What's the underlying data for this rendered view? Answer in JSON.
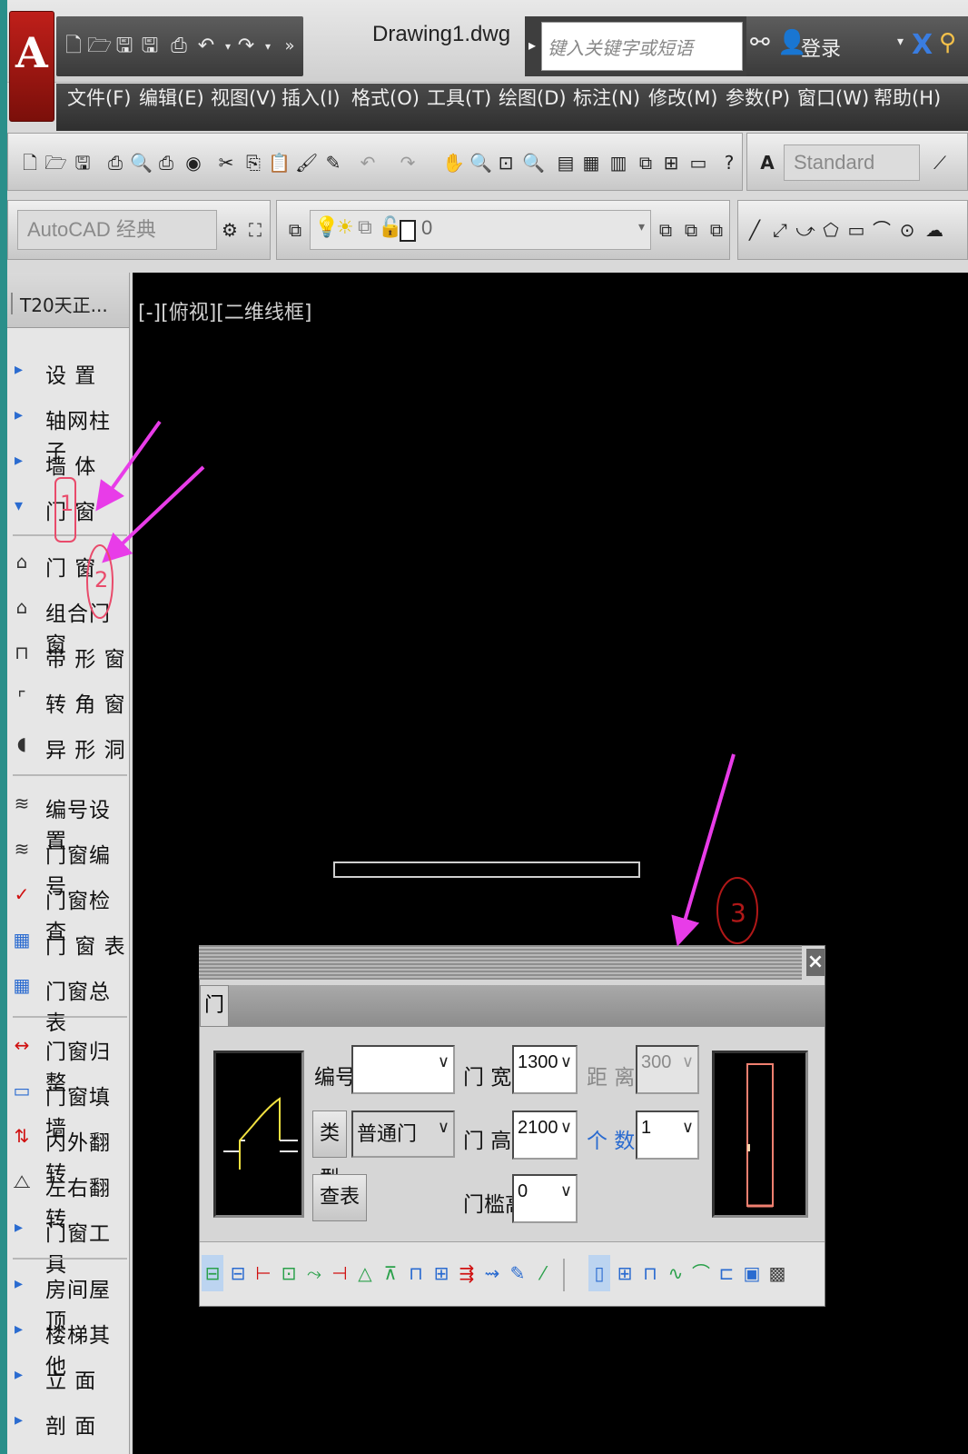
{
  "window": {
    "document_title": "Drawing1.dwg",
    "search_placeholder": "键入关键字或短语",
    "login_label": "登录"
  },
  "menu": [
    "文件(F)",
    "编辑(E)",
    "视图(V)",
    "插入(I)",
    "格式(O)",
    "工具(T)",
    "绘图(D)",
    "标注(N)",
    "修改(M)",
    "参数(P)",
    "窗口(W)",
    "帮助(H)"
  ],
  "toolbar": {
    "text_style": "Standard",
    "workspace": "AutoCAD 经典",
    "layer": "0"
  },
  "panel": {
    "title": "T20天正...",
    "items": [
      {
        "label": "设    置",
        "kind": "section",
        "icon": "expand-arrow"
      },
      {
        "label": "轴网柱子",
        "kind": "section",
        "icon": "expand-arrow"
      },
      {
        "label": "墙    体",
        "kind": "section",
        "icon": "expand-arrow"
      },
      {
        "label": "门    窗",
        "kind": "section-open",
        "icon": "collapse-arrow"
      },
      {
        "label": "门    窗",
        "kind": "tool",
        "icon": "door-icon"
      },
      {
        "label": "组合门窗",
        "kind": "tool",
        "icon": "combo-window-icon"
      },
      {
        "label": "带 形 窗",
        "kind": "tool",
        "icon": "strip-window-icon"
      },
      {
        "label": "转 角 窗",
        "kind": "tool",
        "icon": "corner-window-icon"
      },
      {
        "label": "异 形 洞",
        "kind": "tool",
        "icon": "special-hole-icon"
      },
      {
        "label": "编号设置",
        "kind": "tool",
        "icon": "numbering-setting-icon"
      },
      {
        "label": "门窗编号",
        "kind": "tool",
        "icon": "window-number-icon"
      },
      {
        "label": "门窗检查",
        "kind": "tool",
        "icon": "window-check-icon"
      },
      {
        "label": "门 窗 表",
        "kind": "tool",
        "icon": "window-table-icon"
      },
      {
        "label": "门窗总表",
        "kind": "tool",
        "icon": "window-summary-icon"
      },
      {
        "label": "门窗归整",
        "kind": "tool",
        "icon": "window-align-icon"
      },
      {
        "label": "门窗填墙",
        "kind": "tool",
        "icon": "window-fill-icon"
      },
      {
        "label": "内外翻转",
        "kind": "tool",
        "icon": "flip-inout-icon"
      },
      {
        "label": "左右翻转",
        "kind": "tool",
        "icon": "flip-leftright-icon"
      },
      {
        "label": "门窗工具",
        "kind": "section",
        "icon": "expand-arrow"
      },
      {
        "label": "房间屋顶",
        "kind": "section",
        "icon": "expand-arrow"
      },
      {
        "label": "楼梯其他",
        "kind": "section",
        "icon": "expand-arrow"
      },
      {
        "label": "立    面",
        "kind": "section",
        "icon": "expand-arrow"
      },
      {
        "label": "剖    面",
        "kind": "section",
        "icon": "expand-arrow"
      }
    ]
  },
  "viewport": {
    "label": "[-][俯视][二维线框]"
  },
  "dialog": {
    "tab": "门",
    "number_label": "编号",
    "number_value": "",
    "type_button": "类型",
    "type_value": "普通门",
    "lookup_button": "查表",
    "width_label": "门  宽",
    "width_value": "1300",
    "height_label": "门  高",
    "height_value": "2100",
    "sill_label": "门槛高",
    "sill_value": "0",
    "distance_label": "距  离",
    "distance_value": "300",
    "count_label": "个  数",
    "count_value": "1"
  },
  "annotations": [
    "1",
    "2",
    "3"
  ],
  "colors": {
    "annotation_arrow": "#e83ce8",
    "annotation_mark": "#e94b6b",
    "annotation_circle3": "#b01818"
  }
}
